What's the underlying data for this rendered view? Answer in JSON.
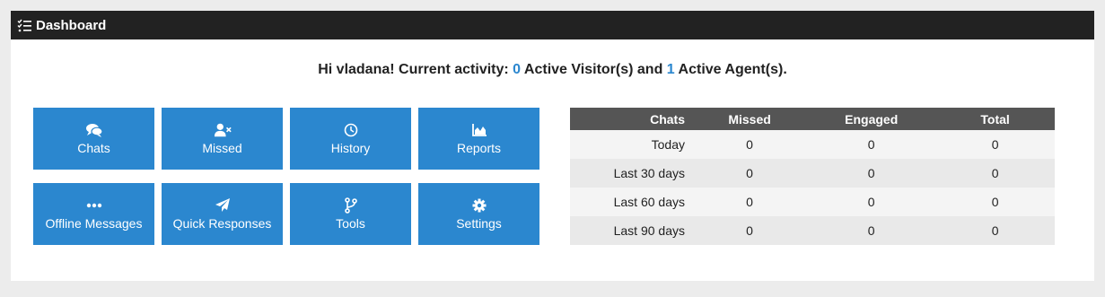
{
  "header": {
    "title": "Dashboard",
    "icon": "task-list-icon"
  },
  "greeting": {
    "prefix": "Hi vladana! Current activity: ",
    "visitors": "0",
    "middle": " Active Visitor(s) and ",
    "agents": "1",
    "suffix": " Active Agent(s)."
  },
  "tiles": [
    {
      "label": "Chats",
      "icon": "chat-bubbles-icon"
    },
    {
      "label": "Missed",
      "icon": "user-x-icon"
    },
    {
      "label": "History",
      "icon": "clock-icon"
    },
    {
      "label": "Reports",
      "icon": "area-chart-icon"
    },
    {
      "label": "Offline Messages",
      "icon": "ellipsis-icon"
    },
    {
      "label": "Quick Responses",
      "icon": "paper-plane-icon"
    },
    {
      "label": "Tools",
      "icon": "code-branch-icon"
    },
    {
      "label": "Settings",
      "icon": "gear-icon"
    }
  ],
  "stats": {
    "headers": [
      "Chats",
      "Missed",
      "Engaged",
      "Total"
    ],
    "rows": [
      [
        "Today",
        "0",
        "0",
        "0"
      ],
      [
        "Last 30 days",
        "0",
        "0",
        "0"
      ],
      [
        "Last 60 days",
        "0",
        "0",
        "0"
      ],
      [
        "Last 90 days",
        "0",
        "0",
        "0"
      ]
    ]
  },
  "colors": {
    "accent": "#2b87cf",
    "header_bg": "#222222",
    "table_header_bg": "#555555"
  }
}
